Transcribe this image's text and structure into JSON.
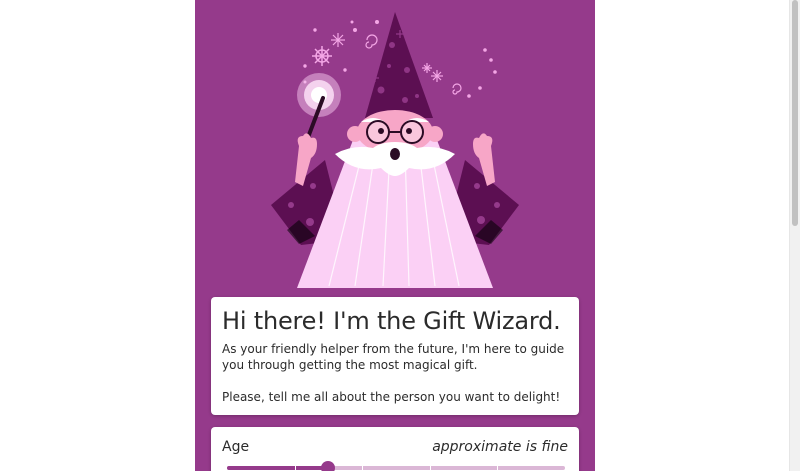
{
  "intro": {
    "title": "Hi there! I'm the Gift Wizard.",
    "paragraph_1": "As your friendly helper from the future, I'm here to guide you through getting the most magical gift.",
    "paragraph_2": "Please, tell me all about the person you want to delight!"
  },
  "age": {
    "label": "Age",
    "hint": "approximate is fine",
    "slider_value_fraction": 0.3
  },
  "colors": {
    "brand": "#953a8b",
    "card": "#ffffff",
    "robe": "#fbd0f5",
    "hat": "#5c0f52"
  },
  "icons": {
    "hero": "wizard-illustration"
  }
}
